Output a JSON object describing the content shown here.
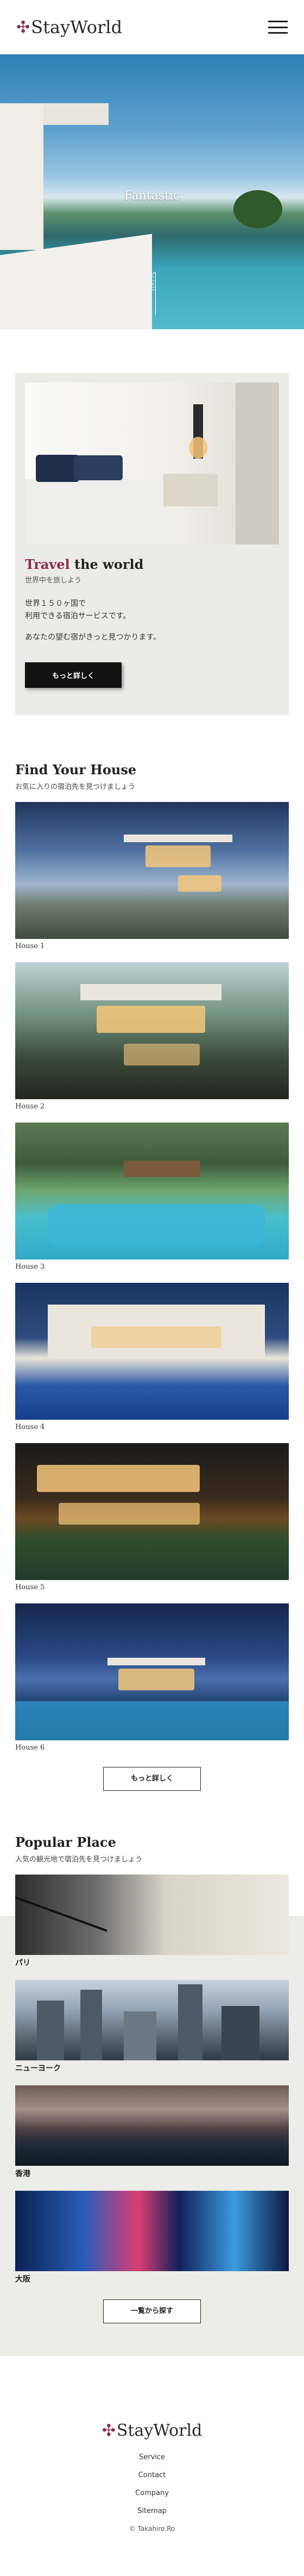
{
  "header": {
    "logo_text": "StayWorld",
    "menu_icon": "hamburger-menu-icon"
  },
  "hero": {
    "title": "Fantastic",
    "scroll_label": "Scroll"
  },
  "travel": {
    "title_accent": "Travel",
    "title_rest": " the world",
    "subtitle": "世界中を旅しよう",
    "body_line1": "世界１５０ヶ国で",
    "body_line2": "利用できる宿泊サービスです。",
    "body_line3": "あなたの望む宿がきっと見つかります。",
    "button_label": "もっと詳しく"
  },
  "find": {
    "title": "Find Your House",
    "subtitle": "お気に入りの宿泊先を見つけましょう",
    "houses": [
      {
        "caption": "House 1"
      },
      {
        "caption": "House 2"
      },
      {
        "caption": "House 3"
      },
      {
        "caption": "House 4"
      },
      {
        "caption": "House 5"
      },
      {
        "caption": "House 6"
      }
    ],
    "button_label": "もっと詳しく"
  },
  "popular": {
    "title": "Popular Place",
    "subtitle": "人気の観光地で宿泊先を見つけましょう",
    "places": [
      {
        "caption": "パリ"
      },
      {
        "caption": "ニューヨーク"
      },
      {
        "caption": "香港"
      },
      {
        "caption": "大阪"
      }
    ],
    "button_label": "一覧から探す"
  },
  "footer": {
    "logo_text": "StayWorld",
    "links": [
      "Service",
      "Contact",
      "Company",
      "Sitemap"
    ],
    "copyright": "© Takahiro.Ro"
  },
  "colors": {
    "accent": "#8b2d4e",
    "button_dark": "#111111",
    "card_bg": "#ebebe7"
  }
}
